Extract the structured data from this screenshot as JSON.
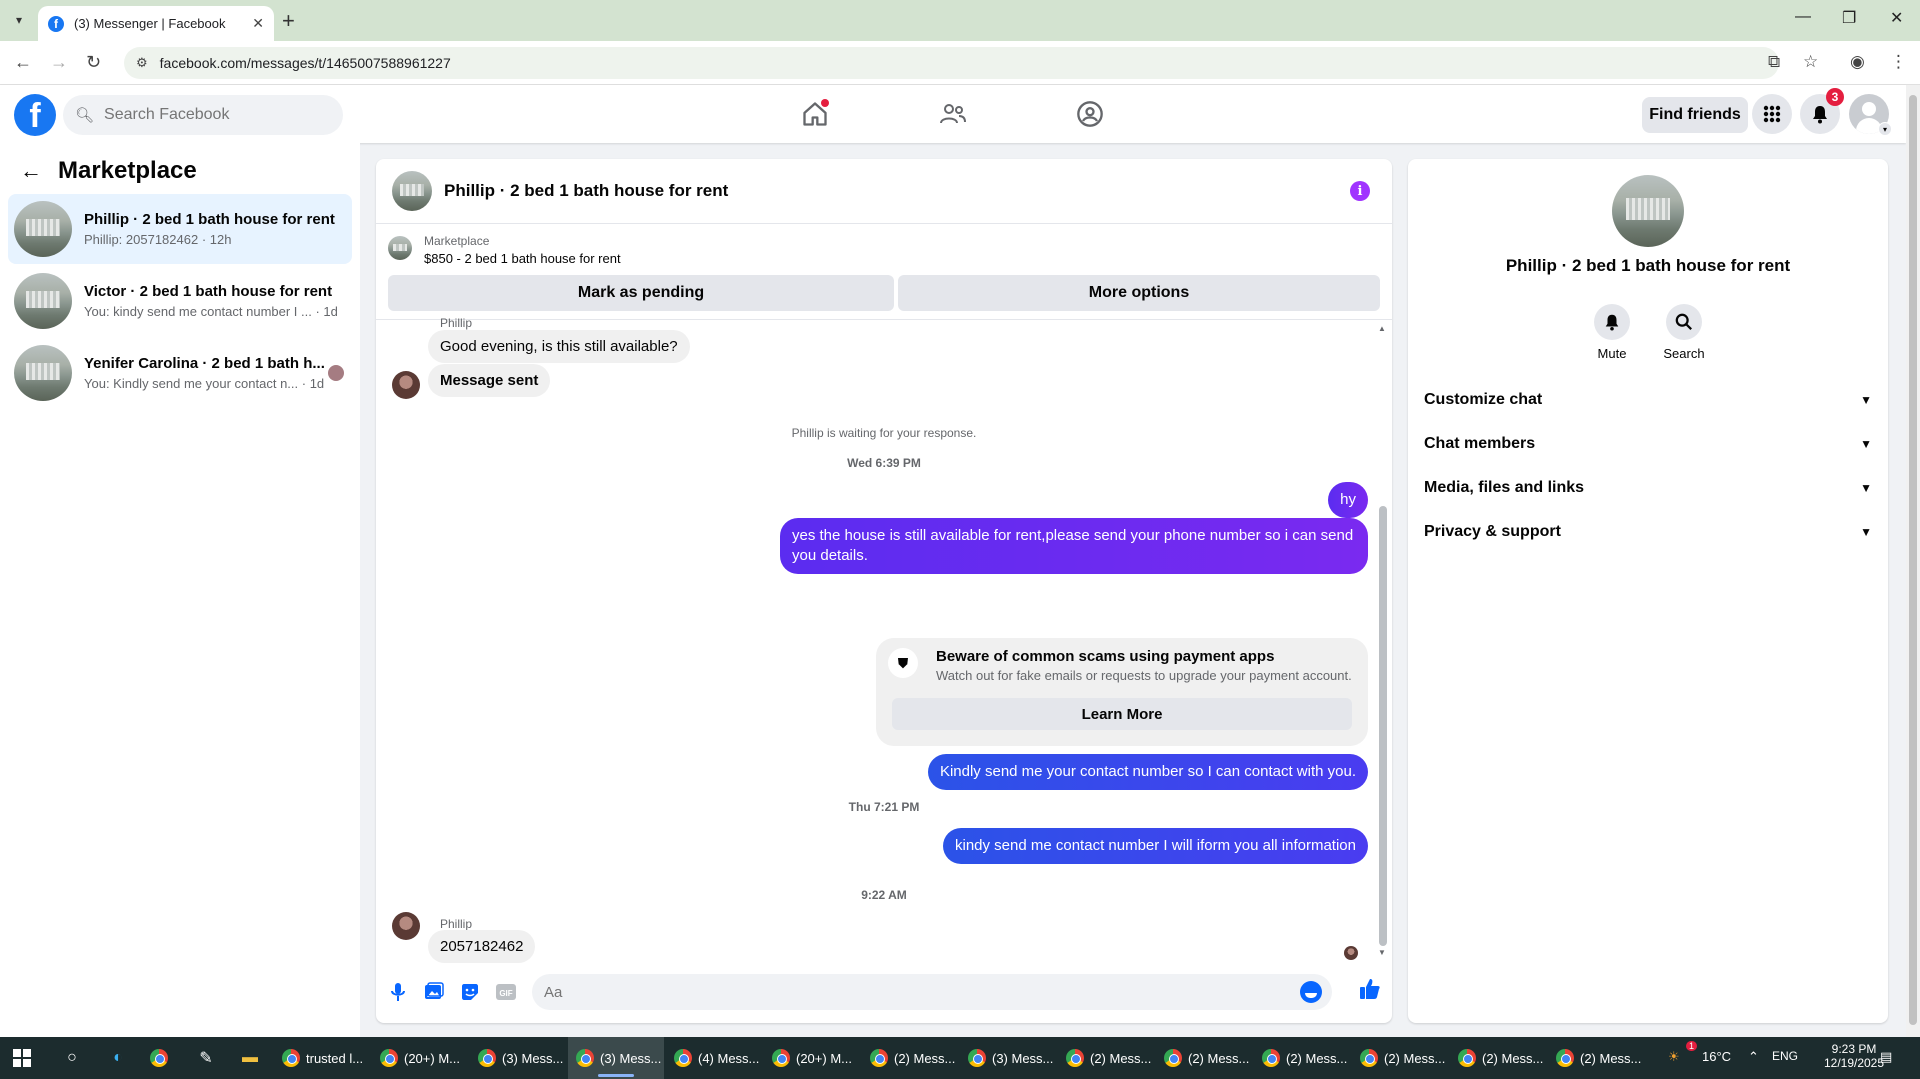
{
  "browser": {
    "tab_title": "(3) Messenger | Facebook",
    "url": "facebook.com/messages/t/1465007588961227"
  },
  "fb_header": {
    "search_placeholder": "Search Facebook",
    "find_friends": "Find friends",
    "notifications_count": "3"
  },
  "sidebar": {
    "title": "Marketplace",
    "conversations": [
      {
        "name": "Phillip · 2 bed 1 bath house for rent",
        "snippet": "Phillip: 2057182462 · 12h",
        "active": true
      },
      {
        "name": "Victor · 2 bed 1 bath house for rent",
        "snippet": "You: kindy send me contact number I ... · 1d",
        "active": false
      },
      {
        "name": "Yenifer Carolina · 2 bed 1 bath h...",
        "snippet": "You: Kindly send me your contact n... · 1d",
        "active": false
      }
    ]
  },
  "chat": {
    "title": "Phillip · 2 bed 1 bath house for rent",
    "marketplace_label": "Marketplace",
    "listing": "$850 - 2 bed 1 bath house for rent",
    "mark_pending": "Mark as pending",
    "more_options": "More options",
    "sender_top": "Phillip",
    "msg_in_1": "Good evening, is this still available?",
    "msg_in_2": "Message sent",
    "waiting": "Phillip is waiting for your response.",
    "time_1": "Wed 6:39 PM",
    "msg_out_1": "hy",
    "msg_out_2": "yes the house is still available for rent,please send your phone number so i can send you details.",
    "scam_title": "Beware of common scams using payment apps",
    "scam_text": "Watch out for fake emails or requests to upgrade your payment account.",
    "learn_more": "Learn More",
    "msg_out_3": "Kindly send me your contact number so I can contact with you.",
    "time_2": "Thu 7:21 PM",
    "msg_out_4": "kindy send me contact number I will iform you all information",
    "time_3": "9:22 AM",
    "sender_bottom": "Phillip",
    "msg_in_3": "2057182462",
    "composer_placeholder": "Aa"
  },
  "info_panel": {
    "title": "Phillip · 2 bed 1 bath house for rent",
    "mute": "Mute",
    "search": "Search",
    "sections": [
      "Customize chat",
      "Chat members",
      "Media, files and links",
      "Privacy & support"
    ]
  },
  "taskbar": {
    "apps": [
      "trusted l...",
      "(20+) M...",
      "(3) Mess...",
      "(3) Mess...",
      "(4) Mess...",
      "(20+) M...",
      "(2) Mess...",
      "(3) Mess...",
      "(2) Mess...",
      "(2) Mess...",
      "(2) Mess...",
      "(2) Mess...",
      "(2) Mess...",
      "(2) Mess..."
    ],
    "weather": "16°C",
    "lang": "ENG",
    "time": "9:23 PM",
    "date": "12/19/2025",
    "notif_count": "1"
  },
  "colors": {
    "fb_blue": "#1877f2",
    "messenger_purple": "#7a2af0",
    "badge_red": "#e41e3f"
  }
}
